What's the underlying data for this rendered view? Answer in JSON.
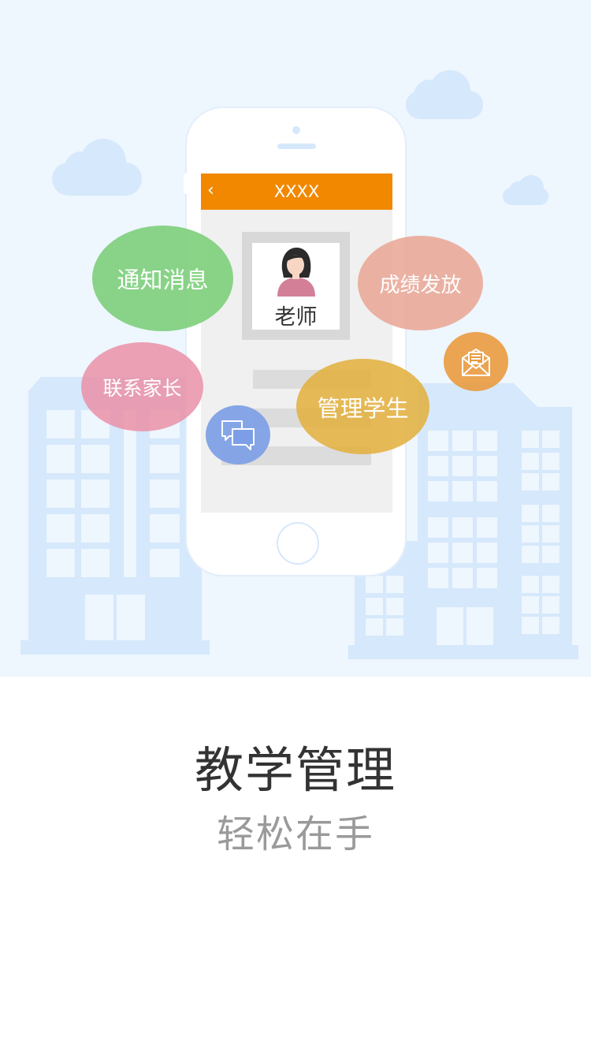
{
  "phone_screen": {
    "header_title": "XXXX",
    "back_icon": "chevron-left-icon",
    "avatar_label": "老师"
  },
  "bubbles": {
    "notice": "通知消息",
    "grades": "成绩发放",
    "contact_parents": "联系家长",
    "manage_students": "管理学生"
  },
  "icons": {
    "mail": "envelope-icon",
    "chat": "chat-bubbles-icon"
  },
  "headline": {
    "title": "教学管理",
    "subtitle": "轻松在手"
  },
  "colors": {
    "header_orange": "#f18800",
    "notice_green": "#7fd17e",
    "grades_salmon": "#e9a894",
    "contact_pink": "#e990a6",
    "manage_gold": "#e2b042",
    "mail_orange": "#ea9b3f",
    "chat_blue": "#7e9ee6",
    "sky": "#eef6fe",
    "building": "#d6e8fb"
  }
}
